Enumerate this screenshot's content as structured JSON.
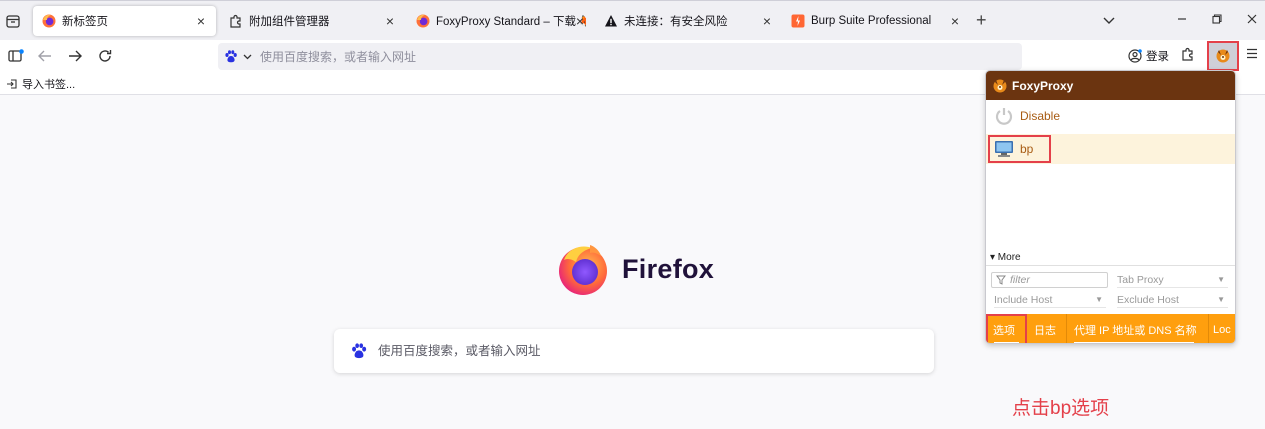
{
  "tabs": [
    {
      "title": "新标签页",
      "icon": "firefox-icon",
      "active": true
    },
    {
      "title": "附加组件管理器",
      "icon": "puzzle-icon",
      "active": false
    },
    {
      "title": "FoxyProxy Standard – 下载 🦊",
      "icon": "firefox-icon",
      "active": false
    },
    {
      "title": "未连接：有安全风险",
      "icon": "warning-icon",
      "active": false
    },
    {
      "title": "Burp Suite Professional",
      "icon": "burp-icon",
      "active": false
    }
  ],
  "navbar": {
    "urlbar_placeholder": "使用百度搜索，或者输入网址",
    "login_label": "登录"
  },
  "bookmarks": {
    "import_label": "导入书签..."
  },
  "newtab": {
    "brand": "Firefox",
    "search_placeholder": "使用百度搜索，或者输入网址"
  },
  "foxyproxy": {
    "title": "FoxyProxy",
    "options": [
      {
        "label": "Disable"
      },
      {
        "label": "bp"
      }
    ],
    "more_label": "▾ More",
    "filter_placeholder": "filter",
    "tab_proxy_label": "Tab Proxy",
    "include_host_label": "Include Host",
    "exclude_host_label": "Exclude Host",
    "bottom_tabs": [
      "选项",
      "日志",
      "代理 IP 地址或 DNS 名称",
      "Loc"
    ]
  },
  "annotation": {
    "caption": "点击bp选项"
  },
  "colors": {
    "highlight": "#e4404a",
    "foxy_header": "#6b3410",
    "foxy_tabbar": "#ff9f0e",
    "foxy_text": "#a85c14"
  }
}
